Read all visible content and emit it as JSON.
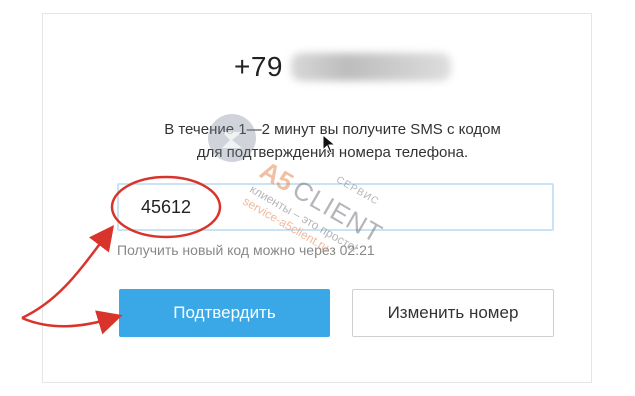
{
  "phone": {
    "prefix": "+79"
  },
  "info": {
    "line1": "В течение 1—2 минут вы получите SMS с кодом",
    "line2": "для подтверждения номера телефона."
  },
  "code_input": {
    "value": "45612"
  },
  "hint": {
    "text": "Получить новый код можно через 02:21"
  },
  "buttons": {
    "confirm_label": "Подтвердить",
    "change_label": "Изменить номер"
  },
  "watermark": {
    "servis": "СЕРВИС",
    "brand": "A5",
    "client": "CLIENT",
    "tagline": "клиенты – это просто!",
    "url": "service-a5client.ru"
  },
  "colors": {
    "accent": "#3aa7e6",
    "annotation": "#d9342b",
    "input_border": "#c9e3f5"
  },
  "icons": {
    "cursor": "mouse-pointer-icon",
    "logo": "a5-logo-icon"
  }
}
